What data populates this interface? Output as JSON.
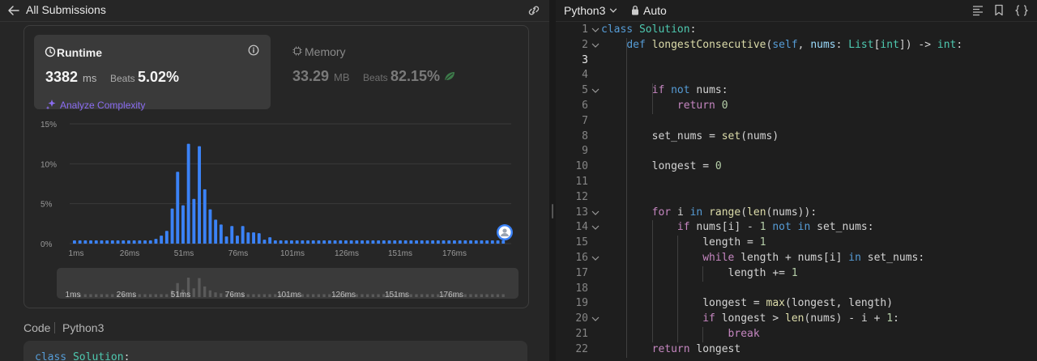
{
  "header": {
    "title": "All Submissions"
  },
  "runtime": {
    "label": "Runtime",
    "value": "3382",
    "unit": "ms",
    "beats_label": "Beats",
    "beats_pct": "5.02%",
    "analyze_label": "Analyze Complexity"
  },
  "memory": {
    "label": "Memory",
    "value": "33.29",
    "unit": "MB",
    "beats_label": "Beats",
    "beats_pct": "82.15%"
  },
  "chart_data": {
    "type": "bar",
    "ytick_labels": [
      "15%",
      "10%",
      "5%",
      "0%"
    ],
    "xtick_labels": [
      "1ms",
      "26ms",
      "51ms",
      "76ms",
      "101ms",
      "126ms",
      "151ms",
      "176ms"
    ],
    "ylim": [
      0,
      15
    ],
    "grid": true,
    "bar_color": "#3b82f6",
    "values": [
      0.4,
      0.4,
      0.4,
      0.4,
      0.4,
      0.4,
      0.4,
      0.4,
      0.4,
      0.4,
      0.4,
      0.4,
      0.4,
      0.4,
      0.4,
      0.6,
      1.0,
      1.6,
      4.4,
      9.0,
      4.8,
      12.5,
      5.6,
      12.2,
      6.8,
      4.3,
      3.0,
      2.4,
      0.9,
      2.2,
      1.0,
      2.2,
      1.4,
      1.4,
      1.3,
      0.5,
      0.8,
      0.4,
      0.4,
      0.4,
      0.4,
      0.4,
      0.4,
      0.4,
      0.4,
      0.4,
      0.4,
      0.4,
      0.4,
      0.4,
      0.4,
      0.4,
      0.4,
      0.4,
      0.4,
      0.4,
      0.4,
      0.4,
      0.4,
      0.4,
      0.4,
      0.4,
      0.4,
      0.4,
      0.4,
      0.4,
      0.4,
      0.4,
      0.4,
      0.4,
      0.4,
      0.4,
      0.4,
      0.4,
      0.4,
      0.4,
      0.4,
      0.4,
      0.4,
      0.4
    ],
    "marker_value": 0.4
  },
  "code_section": {
    "title": "Code",
    "lang": "Python3",
    "preview": "class Solution:"
  },
  "editor": {
    "lang": "Python3",
    "mode": "Auto",
    "current_line": 3,
    "lines": [
      {
        "n": "1",
        "fold": true,
        "t": "class Solution:"
      },
      {
        "n": "2",
        "fold": true,
        "t": "    def longestConsecutive(self, nums: List[int]) -> int:"
      },
      {
        "n": "3",
        "fold": false,
        "t": ""
      },
      {
        "n": "4",
        "fold": false,
        "t": ""
      },
      {
        "n": "5",
        "fold": true,
        "t": "        if not nums:"
      },
      {
        "n": "6",
        "fold": false,
        "t": "            return 0"
      },
      {
        "n": "7",
        "fold": false,
        "t": ""
      },
      {
        "n": "8",
        "fold": false,
        "t": "        set_nums = set(nums)"
      },
      {
        "n": "9",
        "fold": false,
        "t": ""
      },
      {
        "n": "10",
        "fold": false,
        "t": "        longest = 0"
      },
      {
        "n": "11",
        "fold": false,
        "t": ""
      },
      {
        "n": "12",
        "fold": false,
        "t": ""
      },
      {
        "n": "13",
        "fold": true,
        "t": "        for i in range(len(nums)):"
      },
      {
        "n": "14",
        "fold": true,
        "t": "            if nums[i] - 1 not in set_nums:"
      },
      {
        "n": "15",
        "fold": false,
        "t": "                length = 1"
      },
      {
        "n": "16",
        "fold": true,
        "t": "                while length + nums[i] in set_nums:"
      },
      {
        "n": "17",
        "fold": false,
        "t": "                    length += 1"
      },
      {
        "n": "18",
        "fold": false,
        "t": ""
      },
      {
        "n": "19",
        "fold": false,
        "t": "                longest = max(longest, length)"
      },
      {
        "n": "20",
        "fold": true,
        "t": "                if longest > len(nums) - i + 1:"
      },
      {
        "n": "21",
        "fold": false,
        "t": "                    break"
      },
      {
        "n": "22",
        "fold": false,
        "t": "        return longest"
      }
    ]
  }
}
